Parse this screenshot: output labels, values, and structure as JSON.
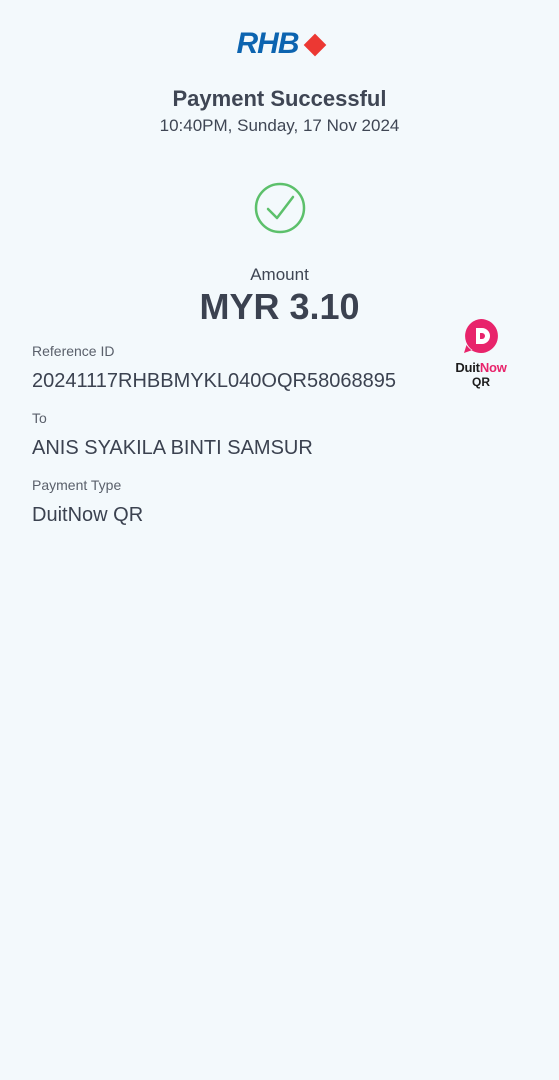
{
  "header": {
    "logo_text": "RHB",
    "title": "Payment Successful",
    "datetime": "10:40PM, Sunday, 17 Nov 2024"
  },
  "status_icon": "check-circle-icon",
  "amount": {
    "label": "Amount",
    "value": "MYR 3.10"
  },
  "details": {
    "reference": {
      "label": "Reference ID",
      "value": "20241117RHBBMYKL040OQR58068895"
    },
    "to": {
      "label": "To",
      "value": "ANIS SYAKILA BINTI SAMSUR"
    },
    "payment_type": {
      "label": "Payment Type",
      "value": "DuitNow QR"
    }
  },
  "duitnow_badge": {
    "brand_part1": "Duit",
    "brand_part2": "Now",
    "sub": "QR"
  },
  "colors": {
    "background": "#f3f9fc",
    "rhb_blue": "#0c64b0",
    "rhb_red": "#ec3833",
    "success_green": "#5cc06b",
    "duitnow_pink": "#e8246b",
    "text": "#3b4250"
  }
}
